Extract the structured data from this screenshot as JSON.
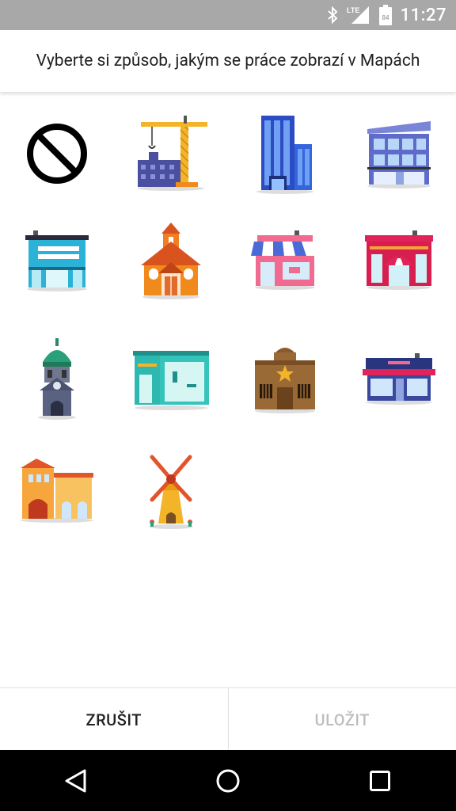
{
  "status_bar": {
    "time": "11:27",
    "network": "LTE",
    "battery": "84",
    "icons": [
      "bluetooth-icon",
      "signal-icon",
      "battery-icon"
    ]
  },
  "dialog": {
    "title": "Vyberte si způsob, jakým se práce zobrazí v Mapách",
    "options": [
      {
        "icon": "none-icon"
      },
      {
        "icon": "construction-crane-icon"
      },
      {
        "icon": "skyscraper-icon"
      },
      {
        "icon": "modern-office-icon"
      },
      {
        "icon": "shop-teal-icon"
      },
      {
        "icon": "school-house-icon"
      },
      {
        "icon": "awning-store-icon"
      },
      {
        "icon": "red-boutique-icon"
      },
      {
        "icon": "clock-tower-icon"
      },
      {
        "icon": "gym-icon"
      },
      {
        "icon": "sheriff-office-icon"
      },
      {
        "icon": "navy-store-icon"
      },
      {
        "icon": "villa-icon"
      },
      {
        "icon": "windmill-icon"
      }
    ],
    "cancel_label": "ZRUŠIT",
    "save_label": "ULOŽIT"
  },
  "nav_bar": {
    "buttons": [
      "back-icon",
      "home-icon",
      "recents-icon"
    ]
  },
  "colors": {
    "status_bar_bg": "#a8a8a8",
    "cancel_text": "#212121",
    "save_text_disabled": "#bdbdbd",
    "nav_bar_bg": "#000000"
  }
}
